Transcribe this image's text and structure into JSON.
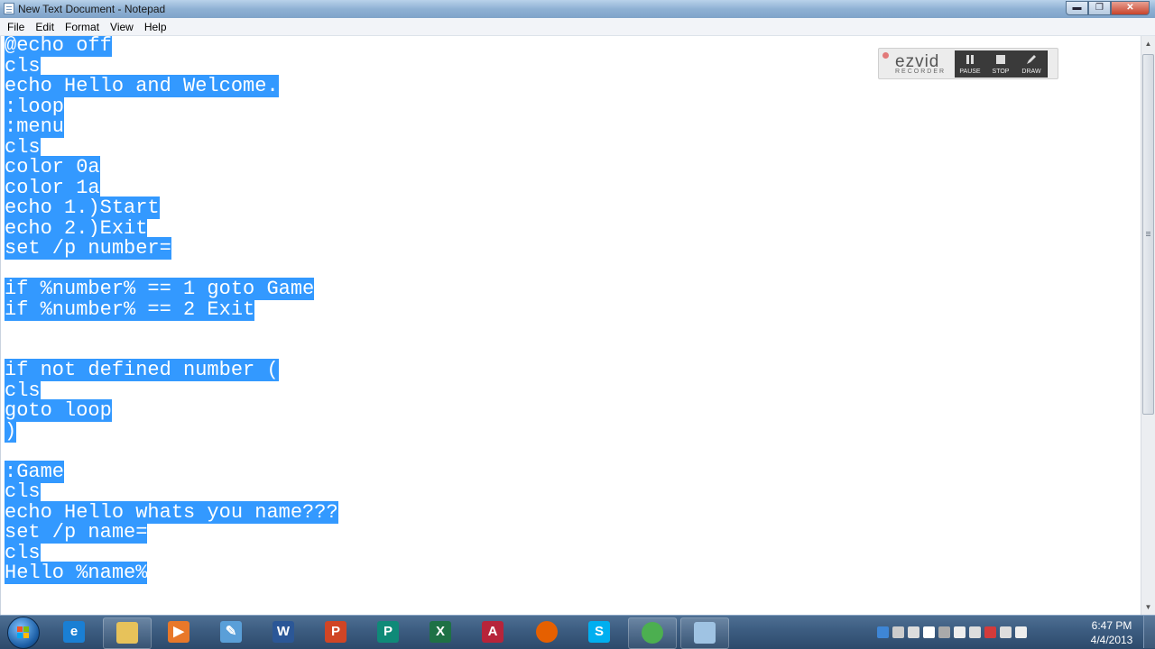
{
  "window": {
    "title": "New Text Document - Notepad",
    "buttons": {
      "minimize": "▬",
      "maximize": "❐",
      "close": "✕"
    }
  },
  "menu": [
    "File",
    "Edit",
    "Format",
    "View",
    "Help"
  ],
  "editor": {
    "selection_color": "#3399ff",
    "lines": [
      "@echo off",
      "cls",
      "echo Hello and Welcome.",
      ":loop",
      ":menu",
      "cls",
      "color 0a",
      "color 1a",
      "echo 1.)Start",
      "echo 2.)Exit",
      "set /p number=",
      "",
      "if %number% == 1 goto Game",
      "if %number% == 2 Exit",
      "",
      "",
      "if not defined number (",
      "cls",
      "goto loop",
      ")",
      "",
      ":Game",
      "cls",
      "echo Hello whats you name???",
      "set /p name=",
      "cls",
      "Hello %name%"
    ]
  },
  "ezvid": {
    "logo": "ezvid",
    "subtitle": "RECORDER",
    "buttons": [
      "PAUSE",
      "STOP",
      "DRAW"
    ]
  },
  "taskbar": {
    "apps": [
      {
        "name": "internet-explorer",
        "glyph": "e",
        "color": "#1a7fd4"
      },
      {
        "name": "windows-explorer",
        "glyph": "",
        "color": "#e7c25a"
      },
      {
        "name": "media-player",
        "glyph": "▶",
        "color": "#e8782a"
      },
      {
        "name": "paint-app",
        "glyph": "✎",
        "color": "#5a9fd8"
      },
      {
        "name": "word",
        "glyph": "W",
        "color": "#2b5797"
      },
      {
        "name": "powerpoint",
        "glyph": "P",
        "color": "#d04525"
      },
      {
        "name": "publisher",
        "glyph": "P",
        "color": "#0f8a78"
      },
      {
        "name": "excel",
        "glyph": "X",
        "color": "#1e7145"
      },
      {
        "name": "access",
        "glyph": "A",
        "color": "#b7243a"
      },
      {
        "name": "firefox",
        "glyph": "",
        "color": "#e66000"
      },
      {
        "name": "skype",
        "glyph": "S",
        "color": "#00aff0"
      },
      {
        "name": "chrome",
        "glyph": "",
        "color": "#4caf50"
      },
      {
        "name": "notepad",
        "glyph": "",
        "color": "#9fc3e3"
      }
    ],
    "tray_icons": [
      "network-icon",
      "steam-icon",
      "display-icon",
      "flag-icon",
      "usb-icon",
      "volume-icon",
      "safely-remove-icon",
      "security-icon",
      "clipboard-icon",
      "signal-icon"
    ],
    "time": "6:47 PM",
    "date": "4/4/2013"
  }
}
